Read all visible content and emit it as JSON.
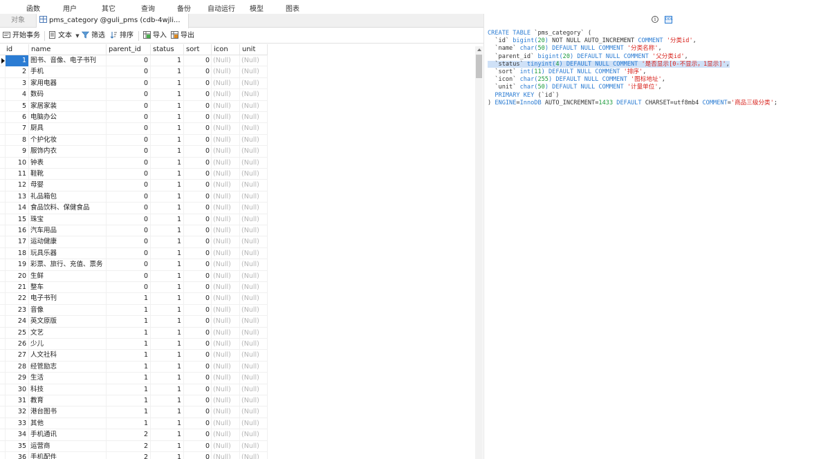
{
  "menu": [
    "函数",
    "用户",
    "其它",
    "查询",
    "备份",
    "自动运行",
    "模型",
    "图表"
  ],
  "tabs": {
    "objects": "对象",
    "table": "pms_category @guli_pms (cdb-4wjli..."
  },
  "toolbar": {
    "begin_tx": "开始事务",
    "text": "文本",
    "filter": "筛选",
    "sort": "排序",
    "import": "导入",
    "export": "导出"
  },
  "grid": {
    "columns": [
      "id",
      "name",
      "parent_id",
      "status",
      "sort",
      "icon",
      "unit"
    ],
    "null_text": "(Null)",
    "rows": [
      [
        "1",
        "图书、音像、电子书刊",
        "0",
        "1",
        "0"
      ],
      [
        "2",
        "手机",
        "0",
        "1",
        "0"
      ],
      [
        "3",
        "家用电器",
        "0",
        "1",
        "0"
      ],
      [
        "4",
        "数码",
        "0",
        "1",
        "0"
      ],
      [
        "5",
        "家居家装",
        "0",
        "1",
        "0"
      ],
      [
        "6",
        "电脑办公",
        "0",
        "1",
        "0"
      ],
      [
        "7",
        "厨具",
        "0",
        "1",
        "0"
      ],
      [
        "8",
        "个护化妆",
        "0",
        "1",
        "0"
      ],
      [
        "9",
        "服饰内衣",
        "0",
        "1",
        "0"
      ],
      [
        "10",
        "钟表",
        "0",
        "1",
        "0"
      ],
      [
        "11",
        "鞋靴",
        "0",
        "1",
        "0"
      ],
      [
        "12",
        "母婴",
        "0",
        "1",
        "0"
      ],
      [
        "13",
        "礼品箱包",
        "0",
        "1",
        "0"
      ],
      [
        "14",
        "食品饮料、保健食品",
        "0",
        "1",
        "0"
      ],
      [
        "15",
        "珠宝",
        "0",
        "1",
        "0"
      ],
      [
        "16",
        "汽车用品",
        "0",
        "1",
        "0"
      ],
      [
        "17",
        "运动健康",
        "0",
        "1",
        "0"
      ],
      [
        "18",
        "玩具乐器",
        "0",
        "1",
        "0"
      ],
      [
        "19",
        "彩票、旅行、充值、票务",
        "0",
        "1",
        "0"
      ],
      [
        "20",
        "生鲜",
        "0",
        "1",
        "0"
      ],
      [
        "21",
        "整车",
        "0",
        "1",
        "0"
      ],
      [
        "22",
        "电子书刊",
        "1",
        "1",
        "0"
      ],
      [
        "23",
        "音像",
        "1",
        "1",
        "0"
      ],
      [
        "24",
        "英文原版",
        "1",
        "1",
        "0"
      ],
      [
        "25",
        "文艺",
        "1",
        "1",
        "0"
      ],
      [
        "26",
        "少儿",
        "1",
        "1",
        "0"
      ],
      [
        "27",
        "人文社科",
        "1",
        "1",
        "0"
      ],
      [
        "28",
        "经管励志",
        "1",
        "1",
        "0"
      ],
      [
        "29",
        "生活",
        "1",
        "1",
        "0"
      ],
      [
        "30",
        "科技",
        "1",
        "1",
        "0"
      ],
      [
        "31",
        "教育",
        "1",
        "1",
        "0"
      ],
      [
        "32",
        "港台图书",
        "1",
        "1",
        "0"
      ],
      [
        "33",
        "其他",
        "1",
        "1",
        "0"
      ],
      [
        "34",
        "手机通讯",
        "2",
        "1",
        "0"
      ],
      [
        "35",
        "运营商",
        "2",
        "1",
        "0"
      ],
      [
        "36",
        "手机配件",
        "2",
        "1",
        "0"
      ]
    ]
  },
  "ddl": {
    "lines": [
      [
        [
          "k",
          "CREATE TABLE "
        ],
        [
          "p",
          "`pms_category` ("
        ]
      ],
      [
        [
          "p",
          "  `id` "
        ],
        [
          "k",
          "bigint("
        ],
        [
          "n",
          "20"
        ],
        [
          "k",
          ") "
        ],
        [
          "p",
          "NOT NULL AUTO_INCREMENT "
        ],
        [
          "k",
          "COMMENT "
        ],
        [
          "s",
          "'分类id'"
        ],
        [
          "p",
          ","
        ]
      ],
      [
        [
          "p",
          "  `name` "
        ],
        [
          "k",
          "char("
        ],
        [
          "n",
          "50"
        ],
        [
          "k",
          ") DEFAULT NULL COMMENT "
        ],
        [
          "s",
          "'分类名称'"
        ],
        [
          "p",
          ","
        ]
      ],
      [
        [
          "p",
          "  `parent_id` "
        ],
        [
          "k",
          "bigint("
        ],
        [
          "n",
          "20"
        ],
        [
          "k",
          ") DEFAULT NULL COMMENT "
        ],
        [
          "s",
          "'父分类id'"
        ],
        [
          "p",
          ","
        ]
      ],
      [
        [
          "p",
          "  `status` "
        ],
        [
          "k",
          "tinyint("
        ],
        [
          "n",
          "4"
        ],
        [
          "k",
          ") DEFAULT NULL COMMENT "
        ],
        [
          "s",
          "'是否显示[0-不显示，1显示]'"
        ],
        [
          "p",
          ","
        ]
      ],
      [
        [
          "p",
          "  `sort` "
        ],
        [
          "k",
          "int("
        ],
        [
          "n",
          "11"
        ],
        [
          "k",
          ") DEFAULT NULL COMMENT "
        ],
        [
          "s",
          "'排序'"
        ],
        [
          "p",
          ","
        ]
      ],
      [
        [
          "p",
          "  `icon` "
        ],
        [
          "k",
          "char("
        ],
        [
          "n",
          "255"
        ],
        [
          "k",
          ") DEFAULT NULL COMMENT "
        ],
        [
          "s",
          "'图标地址'"
        ],
        [
          "p",
          ","
        ]
      ],
      [
        [
          "p",
          "  `unit` "
        ],
        [
          "k",
          "char("
        ],
        [
          "n",
          "50"
        ],
        [
          "k",
          ") DEFAULT NULL COMMENT "
        ],
        [
          "s",
          "'计量单位'"
        ],
        [
          "p",
          ","
        ]
      ],
      [
        [
          "k",
          "  PRIMARY KEY "
        ],
        [
          "p",
          "(`id`)"
        ]
      ],
      [
        [
          "p",
          ") "
        ],
        [
          "k",
          "ENGINE"
        ],
        [
          "p",
          "="
        ],
        [
          "k",
          "InnoDB "
        ],
        [
          "p",
          "AUTO_INCREMENT="
        ],
        [
          "n",
          "1433 "
        ],
        [
          "k",
          "DEFAULT "
        ],
        [
          "p",
          "CHARSET=utf8mb4 "
        ],
        [
          "k",
          "COMMENT"
        ],
        [
          "p",
          "="
        ],
        [
          "s",
          "'商品三级分类'"
        ],
        [
          "p",
          ";"
        ]
      ]
    ]
  }
}
